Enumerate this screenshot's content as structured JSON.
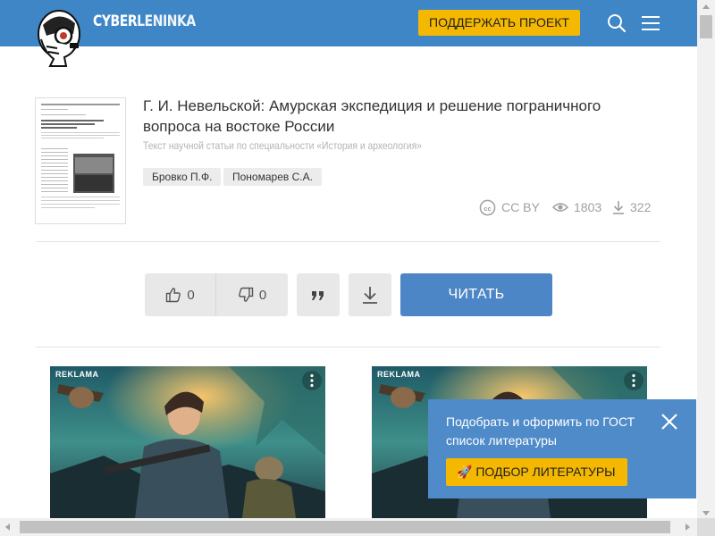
{
  "header": {
    "logo_part1": "CYBER",
    "logo_part2": "LENINKA",
    "support_label": "ПОДДЕРЖАТЬ ПРОЕКТ"
  },
  "article": {
    "title": "Г. И. Невельской: Амурская экспедиция и решение пограничного вопроса на востоке России",
    "subtitle": "Текст научной статьи по специальности «История и археология»",
    "authors": [
      "Бровко П.Ф.",
      "Пономарев С.А."
    ],
    "license": "CC BY",
    "views": "1803",
    "downloads": "322"
  },
  "actions": {
    "likes": "0",
    "dislikes": "0",
    "read_label": "ЧИТАТЬ"
  },
  "ads": [
    {
      "label": "REKLAMA"
    },
    {
      "label": "REKLAMA"
    }
  ],
  "popup": {
    "text": "Подобрать и оформить по ГОСТ список литературы",
    "button_label": "ПОДБОР ЛИТЕРАТУРЫ"
  },
  "colors": {
    "header_bg": "#3f86c7",
    "accent_yellow": "#f5b800",
    "read_button": "#4d86c6",
    "popup_bg": "#4f8bc9"
  },
  "icons": {
    "logo": "robot-head-logo",
    "search": "search-icon",
    "menu": "hamburger-menu-icon",
    "cc": "creative-commons-icon",
    "views": "eye-icon",
    "downloads": "download-icon",
    "like": "thumbs-up-icon",
    "dislike": "thumbs-down-icon",
    "quote": "quote-icon",
    "close": "close-icon",
    "rocket": "rocket-icon"
  }
}
